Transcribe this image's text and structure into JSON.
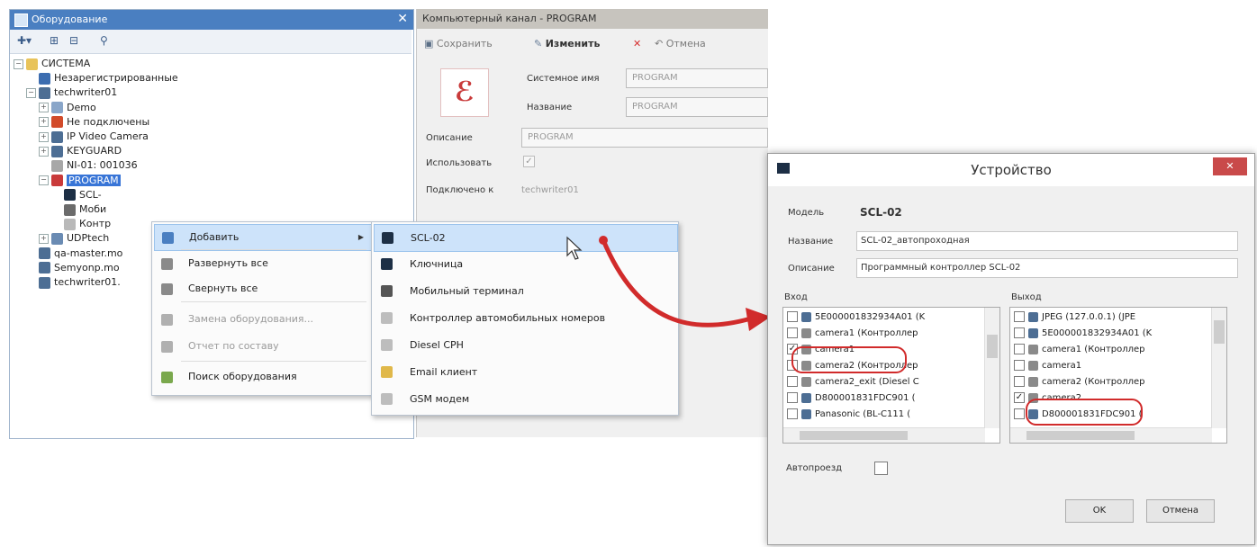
{
  "equipment_panel": {
    "title": "Оборудование",
    "close_glyph": "✕",
    "tree": [
      {
        "label": "СИСТЕМА",
        "icon": "folder-icon",
        "color": "#e8c35a",
        "exp": "−"
      },
      {
        "label": "Незарегистрированные",
        "icon": "unregistered-icon",
        "color": "#3c6db0",
        "exp": ""
      },
      {
        "label": "techwriter01",
        "icon": "computer-icon",
        "color": "#4d6e94",
        "exp": "−"
      },
      {
        "label": "Demo",
        "icon": "globe-icon",
        "color": "#8aa6c9",
        "exp": "+"
      },
      {
        "label": "Не подключены",
        "icon": "disconnected-icon",
        "color": "#d24b2a",
        "exp": "+"
      },
      {
        "label": "IP Video Camera",
        "icon": "camera-icon",
        "color": "#4d6e94",
        "exp": "+"
      },
      {
        "label": "KEYGUARD",
        "icon": "keyguard-icon",
        "color": "#4d6e94",
        "exp": "+"
      },
      {
        "label": "NI-01: 001036",
        "icon": "device-icon",
        "color": "#a7a7a7",
        "exp": ""
      },
      {
        "label": "PROGRAM",
        "icon": "program-icon",
        "color": "#c93a3a",
        "exp": "−"
      },
      {
        "label": "SCL-",
        "icon": "controller-icon",
        "color": "#1d2f45",
        "exp": ""
      },
      {
        "label": "Моби",
        "icon": "mobile-icon",
        "color": "#6b6b6b",
        "exp": ""
      },
      {
        "label": "Контр",
        "icon": "plate-icon",
        "color": "#b9b9b9",
        "exp": ""
      },
      {
        "label": "UDPtech",
        "icon": "network-icon",
        "color": "#6a8bb3",
        "exp": "+"
      },
      {
        "label": "qa-master.mo",
        "icon": "server-icon",
        "color": "#4d6e94",
        "exp": ""
      },
      {
        "label": "Semyonp.mo",
        "icon": "server-icon",
        "color": "#4d6e94",
        "exp": ""
      },
      {
        "label": "techwriter01.",
        "icon": "server-icon",
        "color": "#4d6e94",
        "exp": ""
      }
    ]
  },
  "context_menu": {
    "items": [
      {
        "label": "Добавить",
        "icon": "add-icon",
        "highlighted": true,
        "disabled": false,
        "submenu": true
      },
      {
        "label": "Развернуть все",
        "icon": "expand-all-icon",
        "highlighted": false,
        "disabled": false,
        "submenu": false
      },
      {
        "label": "Свернуть все",
        "icon": "collapse-all-icon",
        "highlighted": false,
        "disabled": false,
        "submenu": false
      },
      {
        "label": "Замена оборудования...",
        "icon": "replace-icon",
        "highlighted": false,
        "disabled": true,
        "submenu": false
      },
      {
        "label": "Отчет по составу",
        "icon": "report-icon",
        "highlighted": false,
        "disabled": true,
        "submenu": false
      },
      {
        "label": "Поиск оборудования",
        "icon": "search-equipment-icon",
        "highlighted": false,
        "disabled": false,
        "submenu": false
      }
    ],
    "submenu_arrow": "▶"
  },
  "submenu": {
    "items": [
      {
        "label": "SCL-02",
        "icon": "controller-icon",
        "color": "#1d2f45",
        "highlighted": true
      },
      {
        "label": "Ключница",
        "icon": "keybox-icon",
        "color": "#1d2f45",
        "highlighted": false
      },
      {
        "label": "Мобильный терминал",
        "icon": "mobile-icon",
        "color": "#555555",
        "highlighted": false
      },
      {
        "label": "Контроллер автомобильных номеров",
        "icon": "plate-icon",
        "color": "#bdbdbd",
        "highlighted": false
      },
      {
        "label": "Diesel CPH",
        "icon": "diesel-icon",
        "color": "#bdbdbd",
        "highlighted": false
      },
      {
        "label": "Email клиент",
        "icon": "email-icon",
        "color": "#e0b84a",
        "highlighted": false
      },
      {
        "label": "GSM модем",
        "icon": "gsm-icon",
        "color": "#bdbdbd",
        "highlighted": false
      }
    ]
  },
  "properties": {
    "title": "Компьютерный канал - PROGRAM",
    "save_label": "Сохранить",
    "edit_label": "Изменить",
    "cancel_label": "Отмена",
    "system_name_label": "Системное имя",
    "system_name_value": "PROGRAM",
    "name_label": "Название",
    "name_value": "PROGRAM",
    "description_label": "Описание",
    "description_value": "PROGRAM",
    "use_label": "Использовать",
    "connected_label": "Подключено к",
    "connected_value": "techwriter01"
  },
  "dialog": {
    "title": "Устройство",
    "close_glyph": "✕",
    "model_label": "Модель",
    "model_value": "SCL-02",
    "name_label": "Название",
    "name_value": "SCL-02_автопроходная",
    "description_label": "Описание",
    "description_value": "Программный контроллер SCL-02",
    "input_label": "Вход",
    "output_label": "Выход",
    "input_items": [
      {
        "label": "5E000001832934A01 (K",
        "checked": false,
        "color": "#4d6e94"
      },
      {
        "label": "camera1 (Контроллер",
        "checked": false,
        "color": "#8a8a8a"
      },
      {
        "label": "camera1",
        "checked": true,
        "color": "#8a8a8a"
      },
      {
        "label": "camera2 (Контроллер",
        "checked": false,
        "color": "#8a8a8a"
      },
      {
        "label": "camera2_exit (Diesel C",
        "checked": false,
        "color": "#8a8a8a"
      },
      {
        "label": "D800001831FDC901 (",
        "checked": false,
        "color": "#4d6e94"
      },
      {
        "label": "Panasonic (BL-C111 (",
        "checked": false,
        "color": "#4d6e94"
      }
    ],
    "output_items": [
      {
        "label": "JPEG (127.0.0.1) (JPE",
        "checked": false,
        "color": "#4d6e94"
      },
      {
        "label": "5E000001832934A01 (K",
        "checked": false,
        "color": "#4d6e94"
      },
      {
        "label": "camera1 (Контроллер",
        "checked": false,
        "color": "#8a8a8a"
      },
      {
        "label": "camera1",
        "checked": false,
        "color": "#8a8a8a"
      },
      {
        "label": "camera2 (Контроллер",
        "checked": false,
        "color": "#8a8a8a"
      },
      {
        "label": "camera2",
        "checked": true,
        "color": "#8a8a8a"
      },
      {
        "label": "D800001831FDC901 (",
        "checked": false,
        "color": "#4d6e94"
      }
    ],
    "autopass_label": "Автопроезд",
    "ok_label": "OK",
    "cancel_label": "Отмена",
    "check_glyph": "✓"
  },
  "colors": {
    "accent": "#4a7fc1",
    "highlight": "#cde3fa",
    "annotation_red": "#d12b2b"
  }
}
